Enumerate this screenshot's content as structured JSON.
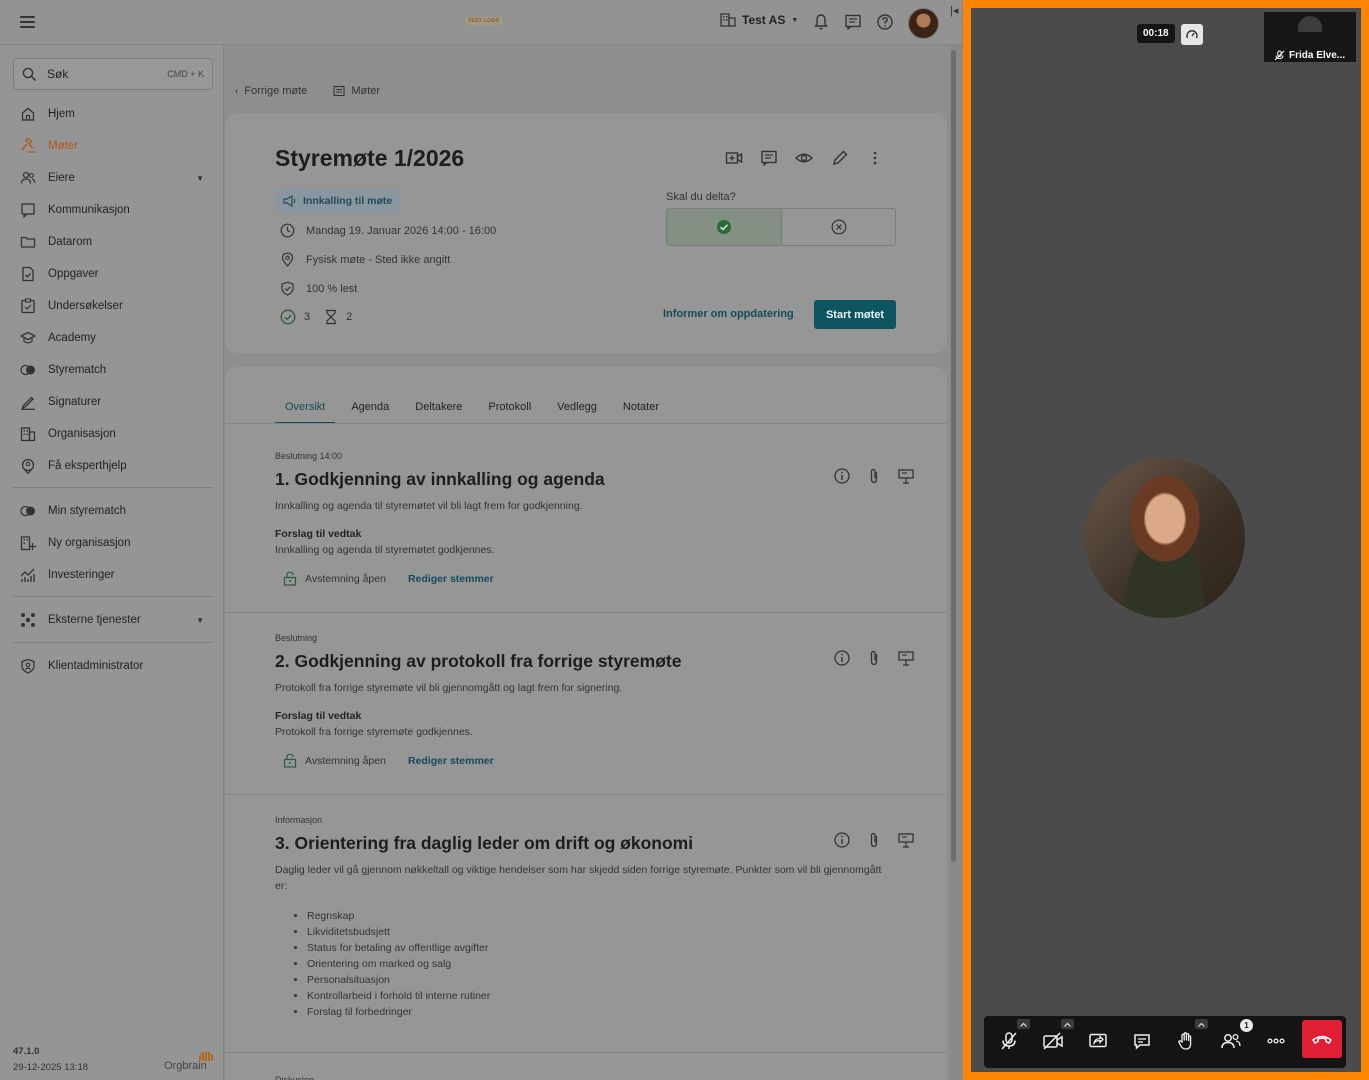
{
  "header": {
    "org_name": "Test AS",
    "logo_text": "TEST LOGO"
  },
  "sidebar": {
    "search_label": "Søk",
    "search_shortcut": "CMD + K",
    "items": [
      {
        "label": "Hjem"
      },
      {
        "label": "Møter"
      },
      {
        "label": "Eiere"
      },
      {
        "label": "Kommunikasjon"
      },
      {
        "label": "Datarom"
      },
      {
        "label": "Oppgaver"
      },
      {
        "label": "Undersøkelser"
      },
      {
        "label": "Academy"
      },
      {
        "label": "Styrematch"
      },
      {
        "label": "Signaturer"
      },
      {
        "label": "Organisasjon"
      },
      {
        "label": "Få eksperthjelp"
      },
      {
        "label": "Min styrematch"
      },
      {
        "label": "Ny organisasjon"
      },
      {
        "label": "Investeringer"
      },
      {
        "label": "Eksterne tjenester"
      },
      {
        "label": "Klientadministrator"
      }
    ],
    "version": "47.1.0",
    "build_date": "29-12-2025 13:18",
    "brand": "Orgbrain"
  },
  "breadcrumb": {
    "back": "Forrige møte",
    "section": "Møter"
  },
  "meeting": {
    "title": "Styremøte 1/2026",
    "badge": "Innkalling til møte",
    "datetime": "Mandag 19. Januar 2026 14:00 - 16:00",
    "location": "Fysisk møte - Sted ikke angitt",
    "read": "100 % lest",
    "accepted_count": "3",
    "pending_count": "2",
    "attend_question": "Skal du delta?",
    "inform_link": "Informer om oppdatering",
    "start_button": "Start møtet"
  },
  "tabs": [
    "Oversikt",
    "Agenda",
    "Deltakere",
    "Protokoll",
    "Vedlegg",
    "Notater"
  ],
  "agenda": [
    {
      "kind": "Beslutning 14:00",
      "title": "1. Godkjenning av innkalling og agenda",
      "description": "Innkalling og agenda til styremøtet vil bli lagt frem for godkjenning.",
      "proposal_label": "Forslag til vedtak",
      "proposal": "Innkalling og agenda til styremøtet godkjennes.",
      "vote_status": "Avstemning åpen",
      "vote_link": "Rediger stemmer"
    },
    {
      "kind": "Beslutning",
      "title": "2. Godkjenning av protokoll fra forrige styremøte",
      "description": "Protokoll fra forrige styremøte vil bli gjennomgått og lagt frem for signering.",
      "proposal_label": "Forslag til vedtak",
      "proposal": "Protokoll fra forrige styremøte godkjennes.",
      "vote_status": "Avstemning åpen",
      "vote_link": "Rediger stemmer"
    },
    {
      "kind": "Informasjon",
      "title": "3. Orientering fra daglig leder om drift og økonomi",
      "description": "Daglig leder vil gå gjennom nøkkeltall og viktige hendelser som har skjedd siden forrige styremøte. Punkter som vil bli gjennomgått er:",
      "bullets": [
        "Regnskap",
        "Likviditetsbudsjett",
        "Status for betaling av offentlige avgifter",
        "Orientering om marked og salg",
        "Personalsituasjon",
        "Kontrollarbeid i forhold til interne rutiner",
        "Forslag til forbedringer"
      ]
    }
  ],
  "next_item_kind": "Diskusjon",
  "video": {
    "timer": "00:18",
    "self_name": "Frida Elve...",
    "participants_count": "1",
    "accent_color": "#ff8400",
    "leave_color": "#e01f34"
  }
}
